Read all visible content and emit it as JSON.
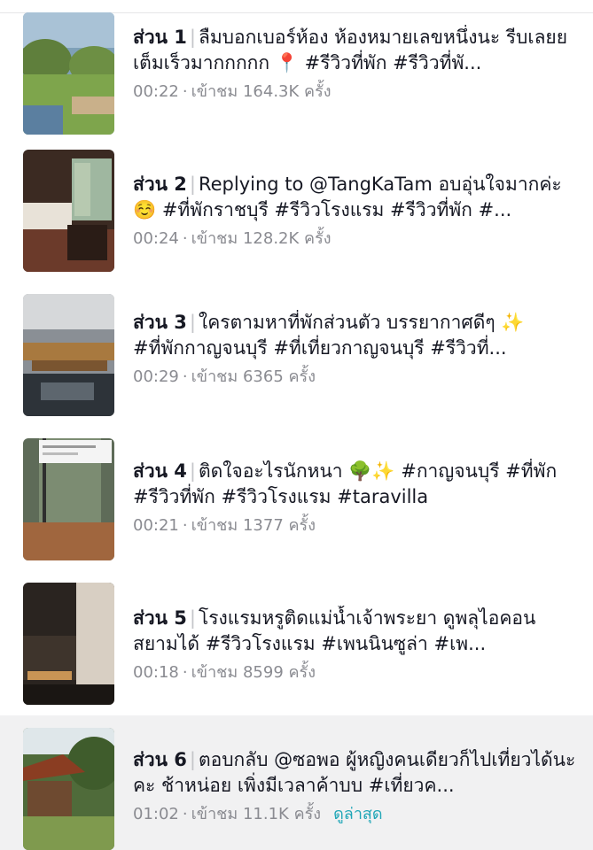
{
  "episodes": [
    {
      "part": "ส่วน 1",
      "title": "ลืมบอกเบอร์ห้อง ห้องหมายเลขหนึ่งนะ รีบเลยย เต็มเร็วมากกกกก 📍 #รีวิวที่พัก #รีวิวที่พั...",
      "duration": "00:22",
      "views": "เข้าชม 164.3K ครั้ง",
      "latest": ""
    },
    {
      "part": "ส่วน 2",
      "title": "Replying to @TangKaTam อบอุ่นใจมากค่ะ ☺️ #ที่พักราชบุรี #รีวิวโรงแรม #รีวิวที่พัก #...",
      "duration": "00:24",
      "views": "เข้าชม 128.2K ครั้ง",
      "latest": ""
    },
    {
      "part": "ส่วน 3",
      "title": "ใครตามหาที่พักส่วนตัว บรรยากาศดีๆ ✨ #ที่พักกาญจนบุรี #ที่เที่ยวกาญจนบุรี #รีวิวที่...",
      "duration": "00:29",
      "views": "เข้าชม 6365 ครั้ง",
      "latest": ""
    },
    {
      "part": "ส่วน 4",
      "title": "ติดใจอะไรนักหนา 🌳✨ #กาญจนบุรี #ที่พัก #รีวิวที่พัก #รีวิวโรงแรม #taravilla",
      "duration": "00:21",
      "views": "เข้าชม 1377 ครั้ง",
      "latest": ""
    },
    {
      "part": "ส่วน 5",
      "title": "โรงแรมหรูติดแม่น้ำเจ้าพระยา ดูพลุไอคอนสยามได้ #รีวิวโรงแรม #เพนนินซูล่า #เพ...",
      "duration": "00:18",
      "views": "เข้าชม 8599 ครั้ง",
      "latest": ""
    },
    {
      "part": "ส่วน 6",
      "title": "ตอบกลับ @ซอพอ ผู้หญิงคนเดียวก็ไปเที่ยวได้นะคะ ช้าหน่อย เพิ่งมีเวลาค้าบบ #เที่ยวค...",
      "duration": "01:02",
      "views": "เข้าชม 11.1K ครั้ง",
      "latest": "ดูล่าสุด"
    }
  ],
  "colors": {
    "accent": "#20a6b7",
    "meta": "#8a8b91",
    "active_bg": "#f1f1f2"
  }
}
